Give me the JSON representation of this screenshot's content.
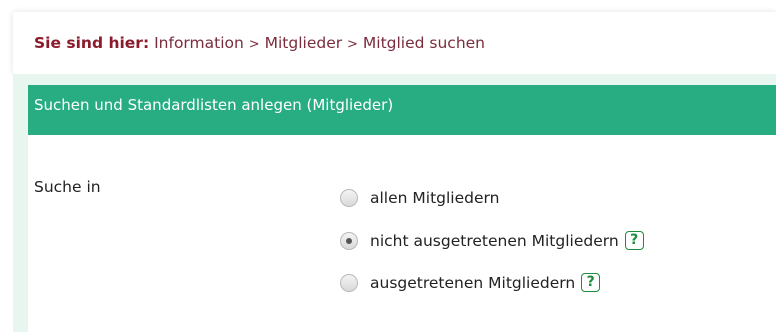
{
  "breadcrumb": {
    "prefix": "Sie sind hier:",
    "items": [
      "Information",
      "Mitglieder",
      "Mitglied suchen"
    ],
    "separator": ">"
  },
  "panel": {
    "title": "Suchen und Standardlisten anlegen (Mitglieder)"
  },
  "search": {
    "label": "Suche in",
    "selected": "nicht ausgetretenen Mitgliedern",
    "options": [
      {
        "label": "allen Mitgliedern",
        "checked": false,
        "help": false
      },
      {
        "label": "nicht ausgetretenen Mitgliedern",
        "checked": true,
        "help": true
      },
      {
        "label": "ausgetretenen Mitgliedern",
        "checked": false,
        "help": true
      }
    ],
    "help_glyph": "?"
  },
  "colors": {
    "header_bg": "#27ad81",
    "breadcrumb_text": "#7a2d3c",
    "content_bg": "#e8f6f0",
    "help_icon": "#1e8c3a"
  }
}
